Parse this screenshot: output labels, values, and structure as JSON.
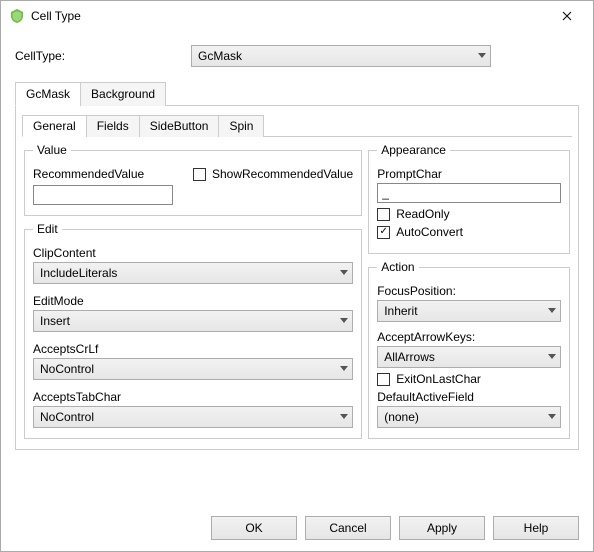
{
  "window": {
    "title": "Cell Type"
  },
  "celltype": {
    "label": "CellType:",
    "value": "GcMask"
  },
  "tabs": {
    "main": [
      "GcMask",
      "Background"
    ],
    "active": "GcMask",
    "sub": [
      "General",
      "Fields",
      "SideButton",
      "Spin"
    ],
    "subActive": "General"
  },
  "value": {
    "legend": "Value",
    "recommended_label": "RecommendedValue",
    "recommended_value": "",
    "show_recommended_label": "ShowRecommendedValue",
    "show_recommended_checked": false
  },
  "edit": {
    "legend": "Edit",
    "clip_label": "ClipContent",
    "clip_value": "IncludeLiterals",
    "mode_label": "EditMode",
    "mode_value": "Insert",
    "crlf_label": "AcceptsCrLf",
    "crlf_value": "NoControl",
    "tab_label": "AcceptsTabChar",
    "tab_value": "NoControl"
  },
  "appearance": {
    "legend": "Appearance",
    "prompt_label": "PromptChar",
    "prompt_value": "_",
    "readonly_label": "ReadOnly",
    "readonly_checked": false,
    "autoconvert_label": "AutoConvert",
    "autoconvert_checked": true
  },
  "action": {
    "legend": "Action",
    "focus_label": "FocusPosition:",
    "focus_value": "Inherit",
    "arrow_label": "AcceptArrowKeys:",
    "arrow_value": "AllArrows",
    "exit_label": "ExitOnLastChar",
    "exit_checked": false,
    "default_field_label": "DefaultActiveField",
    "default_field_value": "(none)"
  },
  "buttons": {
    "ok": "OK",
    "cancel": "Cancel",
    "apply": "Apply",
    "help": "Help"
  }
}
